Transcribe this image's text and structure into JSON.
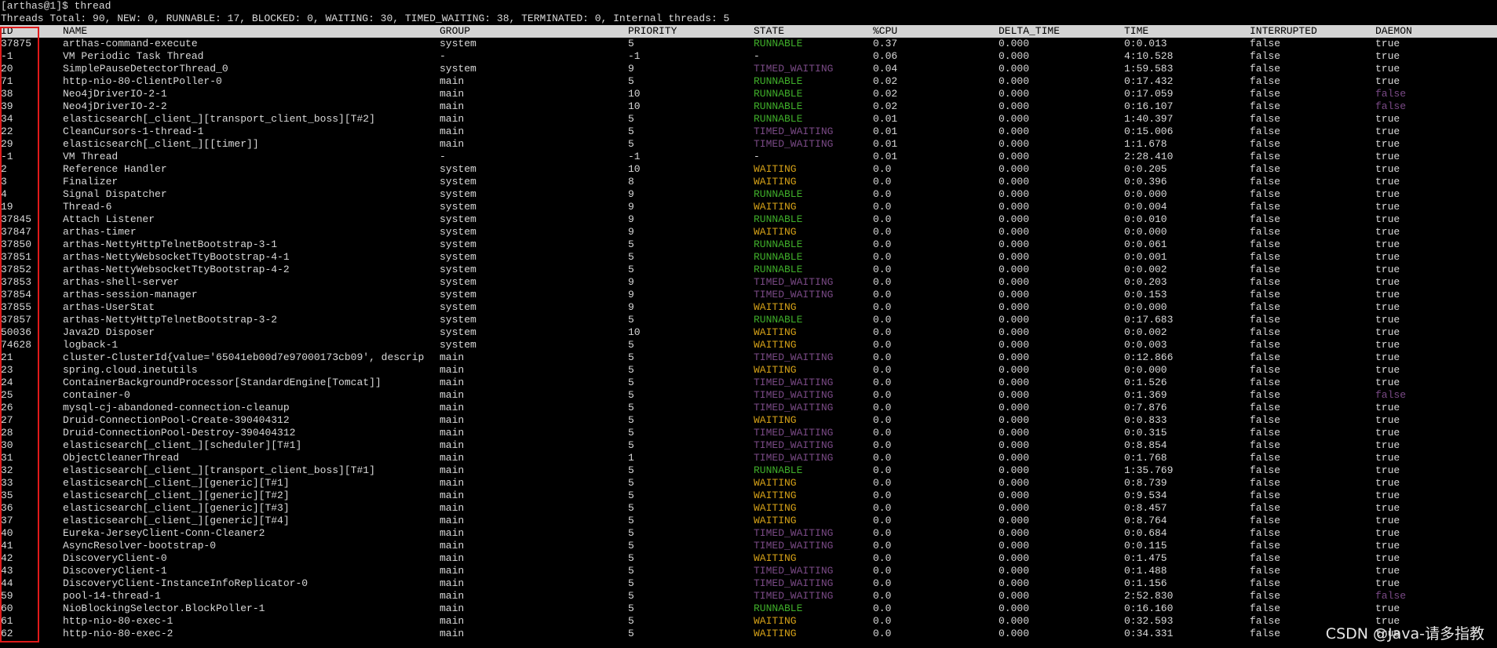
{
  "terminal": {
    "prompt": "[arthas@1]$ thread",
    "summary": "Threads Total: 90, NEW: 0, RUNNABLE: 17, BLOCKED: 0, WAITING: 30, TIMED_WAITING: 38, TERMINATED: 0, Internal threads: 5"
  },
  "table": {
    "headers": {
      "id": "ID",
      "name": "NAME",
      "group": "GROUP",
      "priority": "PRIORITY",
      "state": "STATE",
      "cpu": "%CPU",
      "delta_time": "DELTA_TIME",
      "time": "TIME",
      "interrupted": "INTERRUPTED",
      "daemon": "DAEMON"
    },
    "rows": [
      {
        "id": "37875",
        "name": "arthas-command-execute",
        "group": "system",
        "priority": "5",
        "state": "RUNNABLE",
        "cpu": "0.37",
        "delta": "0.000",
        "time": "0:0.013",
        "interrupted": "false",
        "daemon": "true"
      },
      {
        "id": "-1",
        "name": "VM Periodic Task Thread",
        "group": "-",
        "priority": "-1",
        "state": "-",
        "cpu": "0.06",
        "delta": "0.000",
        "time": "4:10.528",
        "interrupted": "false",
        "daemon": "true"
      },
      {
        "id": "20",
        "name": "SimplePauseDetectorThread_0",
        "group": "system",
        "priority": "9",
        "state": "TIMED_WAITING",
        "cpu": "0.04",
        "delta": "0.000",
        "time": "1:59.583",
        "interrupted": "false",
        "daemon": "true"
      },
      {
        "id": "71",
        "name": "http-nio-80-ClientPoller-0",
        "group": "main",
        "priority": "5",
        "state": "RUNNABLE",
        "cpu": "0.02",
        "delta": "0.000",
        "time": "0:17.432",
        "interrupted": "false",
        "daemon": "true"
      },
      {
        "id": "38",
        "name": "Neo4jDriverIO-2-1",
        "group": "main",
        "priority": "10",
        "state": "RUNNABLE",
        "cpu": "0.02",
        "delta": "0.000",
        "time": "0:17.059",
        "interrupted": "false",
        "daemon": "false"
      },
      {
        "id": "39",
        "name": "Neo4jDriverIO-2-2",
        "group": "main",
        "priority": "10",
        "state": "RUNNABLE",
        "cpu": "0.02",
        "delta": "0.000",
        "time": "0:16.107",
        "interrupted": "false",
        "daemon": "false"
      },
      {
        "id": "34",
        "name": "elasticsearch[_client_][transport_client_boss][T#2]",
        "group": "main",
        "priority": "5",
        "state": "RUNNABLE",
        "cpu": "0.01",
        "delta": "0.000",
        "time": "1:40.397",
        "interrupted": "false",
        "daemon": "true"
      },
      {
        "id": "22",
        "name": "CleanCursors-1-thread-1",
        "group": "main",
        "priority": "5",
        "state": "TIMED_WAITING",
        "cpu": "0.01",
        "delta": "0.000",
        "time": "0:15.006",
        "interrupted": "false",
        "daemon": "true"
      },
      {
        "id": "29",
        "name": "elasticsearch[_client_][[timer]]",
        "group": "main",
        "priority": "5",
        "state": "TIMED_WAITING",
        "cpu": "0.01",
        "delta": "0.000",
        "time": "1:1.678",
        "interrupted": "false",
        "daemon": "true"
      },
      {
        "id": "-1",
        "name": "VM Thread",
        "group": "-",
        "priority": "-1",
        "state": "-",
        "cpu": "0.01",
        "delta": "0.000",
        "time": "2:28.410",
        "interrupted": "false",
        "daemon": "true"
      },
      {
        "id": "2",
        "name": "Reference Handler",
        "group": "system",
        "priority": "10",
        "state": "WAITING",
        "cpu": "0.0",
        "delta": "0.000",
        "time": "0:0.205",
        "interrupted": "false",
        "daemon": "true"
      },
      {
        "id": "3",
        "name": "Finalizer",
        "group": "system",
        "priority": "8",
        "state": "WAITING",
        "cpu": "0.0",
        "delta": "0.000",
        "time": "0:0.396",
        "interrupted": "false",
        "daemon": "true"
      },
      {
        "id": "4",
        "name": "Signal Dispatcher",
        "group": "system",
        "priority": "9",
        "state": "RUNNABLE",
        "cpu": "0.0",
        "delta": "0.000",
        "time": "0:0.000",
        "interrupted": "false",
        "daemon": "true"
      },
      {
        "id": "19",
        "name": "Thread-6",
        "group": "system",
        "priority": "9",
        "state": "WAITING",
        "cpu": "0.0",
        "delta": "0.000",
        "time": "0:0.004",
        "interrupted": "false",
        "daemon": "true"
      },
      {
        "id": "37845",
        "name": "Attach Listener",
        "group": "system",
        "priority": "9",
        "state": "RUNNABLE",
        "cpu": "0.0",
        "delta": "0.000",
        "time": "0:0.010",
        "interrupted": "false",
        "daemon": "true"
      },
      {
        "id": "37847",
        "name": "arthas-timer",
        "group": "system",
        "priority": "9",
        "state": "WAITING",
        "cpu": "0.0",
        "delta": "0.000",
        "time": "0:0.000",
        "interrupted": "false",
        "daemon": "true"
      },
      {
        "id": "37850",
        "name": "arthas-NettyHttpTelnetBootstrap-3-1",
        "group": "system",
        "priority": "5",
        "state": "RUNNABLE",
        "cpu": "0.0",
        "delta": "0.000",
        "time": "0:0.061",
        "interrupted": "false",
        "daemon": "true"
      },
      {
        "id": "37851",
        "name": "arthas-NettyWebsocketTtyBootstrap-4-1",
        "group": "system",
        "priority": "5",
        "state": "RUNNABLE",
        "cpu": "0.0",
        "delta": "0.000",
        "time": "0:0.001",
        "interrupted": "false",
        "daemon": "true"
      },
      {
        "id": "37852",
        "name": "arthas-NettyWebsocketTtyBootstrap-4-2",
        "group": "system",
        "priority": "5",
        "state": "RUNNABLE",
        "cpu": "0.0",
        "delta": "0.000",
        "time": "0:0.002",
        "interrupted": "false",
        "daemon": "true"
      },
      {
        "id": "37853",
        "name": "arthas-shell-server",
        "group": "system",
        "priority": "9",
        "state": "TIMED_WAITING",
        "cpu": "0.0",
        "delta": "0.000",
        "time": "0:0.203",
        "interrupted": "false",
        "daemon": "true"
      },
      {
        "id": "37854",
        "name": "arthas-session-manager",
        "group": "system",
        "priority": "9",
        "state": "TIMED_WAITING",
        "cpu": "0.0",
        "delta": "0.000",
        "time": "0:0.153",
        "interrupted": "false",
        "daemon": "true"
      },
      {
        "id": "37855",
        "name": "arthas-UserStat",
        "group": "system",
        "priority": "9",
        "state": "WAITING",
        "cpu": "0.0",
        "delta": "0.000",
        "time": "0:0.000",
        "interrupted": "false",
        "daemon": "true"
      },
      {
        "id": "37857",
        "name": "arthas-NettyHttpTelnetBootstrap-3-2",
        "group": "system",
        "priority": "5",
        "state": "RUNNABLE",
        "cpu": "0.0",
        "delta": "0.000",
        "time": "0:17.683",
        "interrupted": "false",
        "daemon": "true"
      },
      {
        "id": "50036",
        "name": "Java2D Disposer",
        "group": "system",
        "priority": "10",
        "state": "WAITING",
        "cpu": "0.0",
        "delta": "0.000",
        "time": "0:0.002",
        "interrupted": "false",
        "daemon": "true"
      },
      {
        "id": "74628",
        "name": "logback-1",
        "group": "system",
        "priority": "5",
        "state": "WAITING",
        "cpu": "0.0",
        "delta": "0.000",
        "time": "0:0.003",
        "interrupted": "false",
        "daemon": "true"
      },
      {
        "id": "21",
        "name": "cluster-ClusterId{value='65041eb00d7e97000173cb09', descrip",
        "group": "main",
        "priority": "5",
        "state": "TIMED_WAITING",
        "cpu": "0.0",
        "delta": "0.000",
        "time": "0:12.866",
        "interrupted": "false",
        "daemon": "true"
      },
      {
        "id": "23",
        "name": "spring.cloud.inetutils",
        "group": "main",
        "priority": "5",
        "state": "WAITING",
        "cpu": "0.0",
        "delta": "0.000",
        "time": "0:0.000",
        "interrupted": "false",
        "daemon": "true"
      },
      {
        "id": "24",
        "name": "ContainerBackgroundProcessor[StandardEngine[Tomcat]]",
        "group": "main",
        "priority": "5",
        "state": "TIMED_WAITING",
        "cpu": "0.0",
        "delta": "0.000",
        "time": "0:1.526",
        "interrupted": "false",
        "daemon": "true"
      },
      {
        "id": "25",
        "name": "container-0",
        "group": "main",
        "priority": "5",
        "state": "TIMED_WAITING",
        "cpu": "0.0",
        "delta": "0.000",
        "time": "0:1.369",
        "interrupted": "false",
        "daemon": "false"
      },
      {
        "id": "26",
        "name": "mysql-cj-abandoned-connection-cleanup",
        "group": "main",
        "priority": "5",
        "state": "TIMED_WAITING",
        "cpu": "0.0",
        "delta": "0.000",
        "time": "0:7.876",
        "interrupted": "false",
        "daemon": "true"
      },
      {
        "id": "27",
        "name": "Druid-ConnectionPool-Create-390404312",
        "group": "main",
        "priority": "5",
        "state": "WAITING",
        "cpu": "0.0",
        "delta": "0.000",
        "time": "0:0.833",
        "interrupted": "false",
        "daemon": "true"
      },
      {
        "id": "28",
        "name": "Druid-ConnectionPool-Destroy-390404312",
        "group": "main",
        "priority": "5",
        "state": "TIMED_WAITING",
        "cpu": "0.0",
        "delta": "0.000",
        "time": "0:0.315",
        "interrupted": "false",
        "daemon": "true"
      },
      {
        "id": "30",
        "name": "elasticsearch[_client_][scheduler][T#1]",
        "group": "main",
        "priority": "5",
        "state": "TIMED_WAITING",
        "cpu": "0.0",
        "delta": "0.000",
        "time": "0:8.854",
        "interrupted": "false",
        "daemon": "true"
      },
      {
        "id": "31",
        "name": "ObjectCleanerThread",
        "group": "main",
        "priority": "1",
        "state": "TIMED_WAITING",
        "cpu": "0.0",
        "delta": "0.000",
        "time": "0:1.768",
        "interrupted": "false",
        "daemon": "true"
      },
      {
        "id": "32",
        "name": "elasticsearch[_client_][transport_client_boss][T#1]",
        "group": "main",
        "priority": "5",
        "state": "RUNNABLE",
        "cpu": "0.0",
        "delta": "0.000",
        "time": "1:35.769",
        "interrupted": "false",
        "daemon": "true"
      },
      {
        "id": "33",
        "name": "elasticsearch[_client_][generic][T#1]",
        "group": "main",
        "priority": "5",
        "state": "WAITING",
        "cpu": "0.0",
        "delta": "0.000",
        "time": "0:8.739",
        "interrupted": "false",
        "daemon": "true"
      },
      {
        "id": "35",
        "name": "elasticsearch[_client_][generic][T#2]",
        "group": "main",
        "priority": "5",
        "state": "WAITING",
        "cpu": "0.0",
        "delta": "0.000",
        "time": "0:9.534",
        "interrupted": "false",
        "daemon": "true"
      },
      {
        "id": "36",
        "name": "elasticsearch[_client_][generic][T#3]",
        "group": "main",
        "priority": "5",
        "state": "WAITING",
        "cpu": "0.0",
        "delta": "0.000",
        "time": "0:8.457",
        "interrupted": "false",
        "daemon": "true"
      },
      {
        "id": "37",
        "name": "elasticsearch[_client_][generic][T#4]",
        "group": "main",
        "priority": "5",
        "state": "WAITING",
        "cpu": "0.0",
        "delta": "0.000",
        "time": "0:8.764",
        "interrupted": "false",
        "daemon": "true"
      },
      {
        "id": "40",
        "name": "Eureka-JerseyClient-Conn-Cleaner2",
        "group": "main",
        "priority": "5",
        "state": "TIMED_WAITING",
        "cpu": "0.0",
        "delta": "0.000",
        "time": "0:0.684",
        "interrupted": "false",
        "daemon": "true"
      },
      {
        "id": "41",
        "name": "AsyncResolver-bootstrap-0",
        "group": "main",
        "priority": "5",
        "state": "TIMED_WAITING",
        "cpu": "0.0",
        "delta": "0.000",
        "time": "0:0.115",
        "interrupted": "false",
        "daemon": "true"
      },
      {
        "id": "42",
        "name": "DiscoveryClient-0",
        "group": "main",
        "priority": "5",
        "state": "WAITING",
        "cpu": "0.0",
        "delta": "0.000",
        "time": "0:1.475",
        "interrupted": "false",
        "daemon": "true"
      },
      {
        "id": "43",
        "name": "DiscoveryClient-1",
        "group": "main",
        "priority": "5",
        "state": "TIMED_WAITING",
        "cpu": "0.0",
        "delta": "0.000",
        "time": "0:1.488",
        "interrupted": "false",
        "daemon": "true"
      },
      {
        "id": "44",
        "name": "DiscoveryClient-InstanceInfoReplicator-0",
        "group": "main",
        "priority": "5",
        "state": "TIMED_WAITING",
        "cpu": "0.0",
        "delta": "0.000",
        "time": "0:1.156",
        "interrupted": "false",
        "daemon": "true"
      },
      {
        "id": "59",
        "name": "pool-14-thread-1",
        "group": "main",
        "priority": "5",
        "state": "TIMED_WAITING",
        "cpu": "0.0",
        "delta": "0.000",
        "time": "2:52.830",
        "interrupted": "false",
        "daemon": "false"
      },
      {
        "id": "60",
        "name": "NioBlockingSelector.BlockPoller-1",
        "group": "main",
        "priority": "5",
        "state": "RUNNABLE",
        "cpu": "0.0",
        "delta": "0.000",
        "time": "0:16.160",
        "interrupted": "false",
        "daemon": "true"
      },
      {
        "id": "61",
        "name": "http-nio-80-exec-1",
        "group": "main",
        "priority": "5",
        "state": "WAITING",
        "cpu": "0.0",
        "delta": "0.000",
        "time": "0:32.593",
        "interrupted": "false",
        "daemon": "true"
      },
      {
        "id": "62",
        "name": "http-nio-80-exec-2",
        "group": "main",
        "priority": "5",
        "state": "WAITING",
        "cpu": "0.0",
        "delta": "0.000",
        "time": "0:34.331",
        "interrupted": "false",
        "daemon": "true"
      }
    ]
  },
  "watermark": "CSDN @Java-请多指教",
  "colors": {
    "background": "#000000",
    "text": "#d9d9d9",
    "header_bg": "#d4d4d4",
    "runnable": "#3fae2a",
    "waiting": "#d4a017",
    "timed_waiting": "#7a4a86",
    "highlight_box": "#e01a1a"
  }
}
